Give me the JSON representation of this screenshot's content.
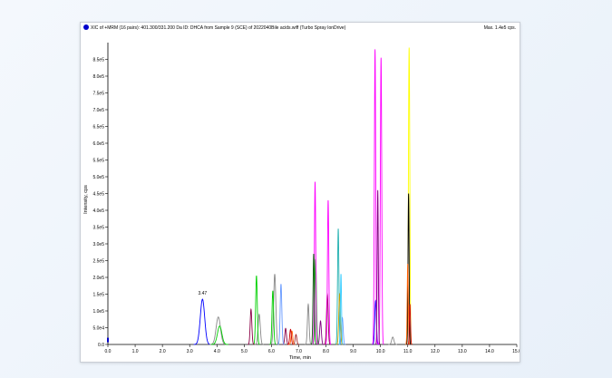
{
  "chart_data": {
    "type": "line",
    "title": "XIC of +MRM (16 pairs): 401.300/331.200 Da ID: DHCA from Sample 9 (SCE) of 2022040Bile acids.wiff (Turbo Spray IonDrive)",
    "max_label": "Max. 1.4e5 cps.",
    "xlabel": "Time, min",
    "ylabel": "Intensity, cps",
    "xlim": [
      0.0,
      15.0
    ],
    "ylim": [
      0,
      900000
    ],
    "x_ticks": [
      "0.0",
      "1.0",
      "2.0",
      "3.0",
      "4.0",
      "5.0",
      "6.0",
      "7.0",
      "8.0",
      "9.0",
      "10.0",
      "11.0",
      "12.0",
      "13.0",
      "14.0",
      "15.0"
    ],
    "y_ticks": [
      "0.0",
      "5.0e4",
      "1.0e5",
      "1.5e5",
      "2.0e5",
      "2.5e5",
      "3.0e5",
      "3.5e5",
      "4.0e5",
      "4.5e5",
      "5.0e5",
      "5.5e5",
      "6.0e5",
      "6.5e5",
      "7.0e5",
      "7.5e5",
      "8.0e5",
      "8.5e5"
    ],
    "y_tick_values": [
      0,
      50000,
      100000,
      150000,
      200000,
      250000,
      300000,
      350000,
      400000,
      450000,
      500000,
      550000,
      600000,
      650000,
      700000,
      750000,
      800000,
      850000
    ],
    "annotations": [
      {
        "text": "3.47",
        "x": 3.47,
        "y": 140000
      }
    ],
    "series": [
      {
        "color": "#0000ff",
        "peaks": [
          {
            "x": 3.47,
            "h": 135000,
            "w": 0.08
          },
          {
            "x": 9.82,
            "h": 130000,
            "w": 0.03
          }
        ]
      },
      {
        "color": "#888888",
        "peaks": [
          {
            "x": 4.05,
            "h": 82000,
            "w": 0.08
          },
          {
            "x": 5.55,
            "h": 90000,
            "w": 0.04
          },
          {
            "x": 6.12,
            "h": 210000,
            "w": 0.04
          },
          {
            "x": 7.35,
            "h": 120000,
            "w": 0.03
          },
          {
            "x": 10.45,
            "h": 22000,
            "w": 0.04
          }
        ]
      },
      {
        "color": "#00d000",
        "peaks": [
          {
            "x": 4.1,
            "h": 55000,
            "w": 0.08
          },
          {
            "x": 5.45,
            "h": 205000,
            "w": 0.03
          },
          {
            "x": 6.05,
            "h": 160000,
            "w": 0.03
          },
          {
            "x": 7.62,
            "h": 255000,
            "w": 0.03
          }
        ]
      },
      {
        "color": "#8b0045",
        "peaks": [
          {
            "x": 5.25,
            "h": 105000,
            "w": 0.03
          },
          {
            "x": 6.52,
            "h": 48000,
            "w": 0.03
          },
          {
            "x": 8.05,
            "h": 150000,
            "w": 0.03
          }
        ]
      },
      {
        "color": "#ff00ff",
        "peaks": [
          {
            "x": 7.6,
            "h": 485000,
            "w": 0.025
          },
          {
            "x": 8.08,
            "h": 430000,
            "w": 0.025
          },
          {
            "x": 9.8,
            "h": 880000,
            "w": 0.025
          },
          {
            "x": 10.02,
            "h": 855000,
            "w": 0.025
          }
        ]
      },
      {
        "color": "#ffff00",
        "peaks": [
          {
            "x": 11.05,
            "h": 885000,
            "w": 0.025
          }
        ]
      },
      {
        "color": "#000000",
        "peaks": [
          {
            "x": 11.03,
            "h": 450000,
            "w": 0.02
          }
        ]
      },
      {
        "color": "#ff6000",
        "peaks": [
          {
            "x": 11.0,
            "h": 240000,
            "w": 0.02
          },
          {
            "x": 6.75,
            "h": 40000,
            "w": 0.03
          }
        ]
      },
      {
        "color": "#20b0b0",
        "peaks": [
          {
            "x": 8.45,
            "h": 345000,
            "w": 0.025
          }
        ]
      },
      {
        "color": "#6699ff",
        "peaks": [
          {
            "x": 6.35,
            "h": 180000,
            "w": 0.03
          },
          {
            "x": 8.6,
            "h": 80000,
            "w": 0.03
          }
        ]
      },
      {
        "color": "#800080",
        "peaks": [
          {
            "x": 9.9,
            "h": 460000,
            "w": 0.02
          },
          {
            "x": 7.8,
            "h": 70000,
            "w": 0.03
          }
        ]
      },
      {
        "color": "#cc0000",
        "peaks": [
          {
            "x": 6.7,
            "h": 45000,
            "w": 0.03
          },
          {
            "x": 11.08,
            "h": 120000,
            "w": 0.02
          }
        ]
      },
      {
        "color": "#c8a000",
        "peaks": [
          {
            "x": 8.5,
            "h": 150000,
            "w": 0.03
          }
        ]
      },
      {
        "color": "#33ccff",
        "peaks": [
          {
            "x": 8.55,
            "h": 210000,
            "w": 0.02
          }
        ]
      },
      {
        "color": "#006400",
        "peaks": [
          {
            "x": 7.55,
            "h": 270000,
            "w": 0.025
          }
        ]
      },
      {
        "color": "#a52a2a",
        "peaks": [
          {
            "x": 6.9,
            "h": 30000,
            "w": 0.03
          }
        ]
      }
    ]
  }
}
